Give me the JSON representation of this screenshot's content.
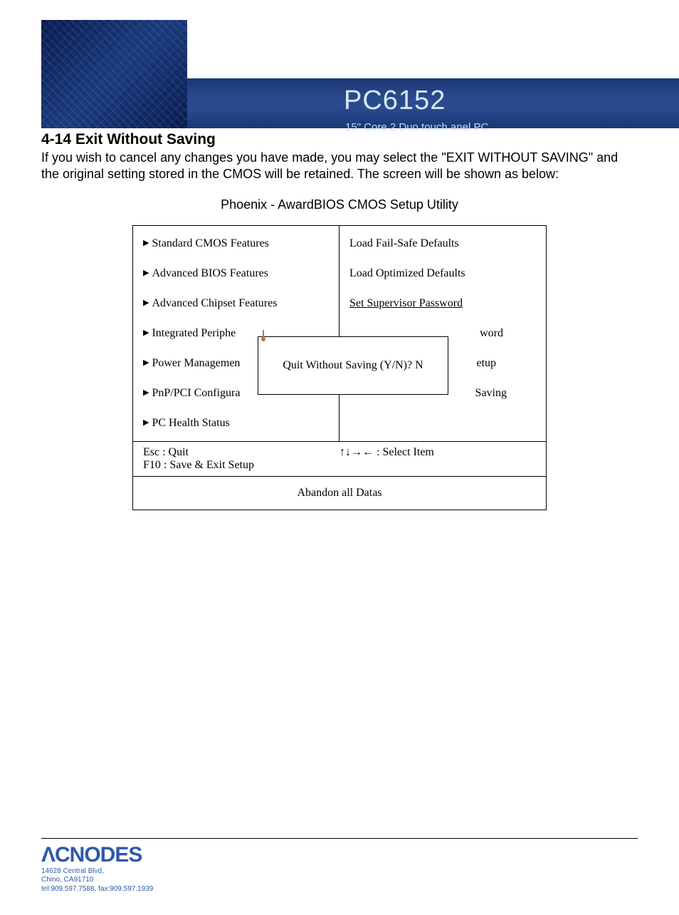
{
  "banner": {
    "title": "PC6152",
    "subtitle": "15\" Core 2 Duo touch anel PC"
  },
  "section": {
    "heading": "4-14  Exit Without Saving",
    "body": "If you wish to cancel any changes you have made, you may select the \"EXIT WITHOUT SAVING\" and the original setting stored in the CMOS will be retained. The screen will be shown as below:",
    "caption": "Phoenix - AwardBIOS CMOS Setup Utility"
  },
  "bios": {
    "left_items": [
      "Standard CMOS Features",
      "Advanced BIOS Features",
      "Advanced Chipset Features",
      "Integrated Periphe",
      "Power Managemen",
      "PnP/PCI Configura",
      "PC Health Status"
    ],
    "right_items": [
      "Load Fail-Safe Defaults",
      "Load Optimized Defaults",
      "Set Supervisor Password",
      "word",
      "etup",
      "Saving",
      ""
    ],
    "dialog_text": "Quit Without Saving (Y/N)? N",
    "hotkeys_left_1": "Esc : Quit",
    "hotkeys_left_2": "F10 : Save & Exit Setup",
    "hotkeys_right": "↑↓→← : Select Item",
    "footer": "Abandon all Datas"
  },
  "page_footer": {
    "logo_text": "CNODES",
    "addr_line1": "14628 Central Blvd,",
    "addr_line2": "Chino, CA91710",
    "addr_line3": "tel:909.597.7588, fax:909.597.1939"
  }
}
